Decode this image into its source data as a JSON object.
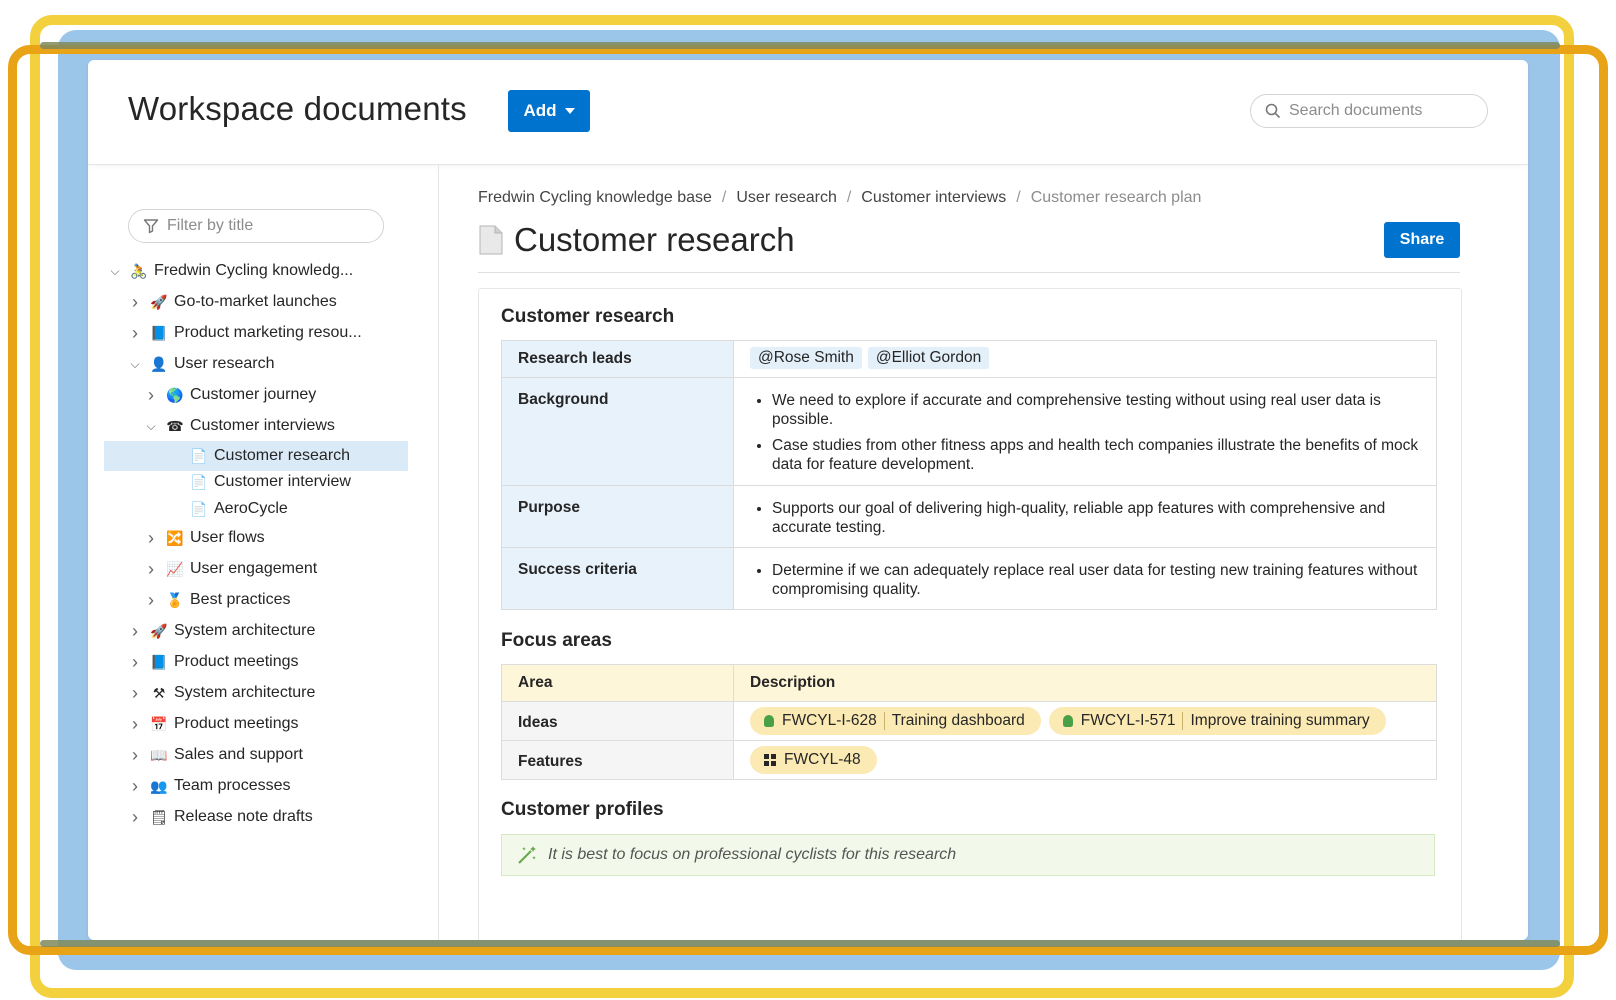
{
  "header": {
    "title": "Workspace documents",
    "add_label": "Add",
    "search_placeholder": "Search documents"
  },
  "sidebar": {
    "filter_placeholder": "Filter by title",
    "items": [
      {
        "label": "Fredwin Cycling knowledg...",
        "icon": "cyclist-icon",
        "glyph": "🚴",
        "expanded": true,
        "depth": 0
      },
      {
        "label": "Go-to-market launches",
        "icon": "rocket-icon",
        "glyph": "🚀",
        "depth": 1
      },
      {
        "label": "Product marketing resou...",
        "icon": "book-icon",
        "glyph": "📘",
        "depth": 1
      },
      {
        "label": "User research",
        "icon": "user-icon",
        "glyph": "👤",
        "expanded": true,
        "depth": 1
      },
      {
        "label": "Customer journey",
        "icon": "globe-icon",
        "glyph": "🌎",
        "depth": 2
      },
      {
        "label": "Customer interviews",
        "icon": "phone-icon",
        "glyph": "☎",
        "expanded": true,
        "depth": 2
      },
      {
        "label": "Customer research",
        "icon": "document-icon",
        "glyph": "📄",
        "depth": 3,
        "selected": true
      },
      {
        "label": "Customer interview",
        "icon": "document-icon",
        "glyph": "📄",
        "depth": 3
      },
      {
        "label": "AeroCycle",
        "icon": "document-icon",
        "glyph": "📄",
        "depth": 3
      },
      {
        "label": "User flows",
        "icon": "flow-icon",
        "glyph": "🔀",
        "depth": 2
      },
      {
        "label": "User engagement",
        "icon": "chart-icon",
        "glyph": "📈",
        "depth": 2
      },
      {
        "label": "Best practices",
        "icon": "medal-icon",
        "glyph": "🏅",
        "depth": 2
      },
      {
        "label": "System architecture",
        "icon": "rocket-icon",
        "glyph": "🚀",
        "depth": 1
      },
      {
        "label": "Product meetings",
        "icon": "book-icon",
        "glyph": "📘",
        "depth": 1
      },
      {
        "label": "System architecture",
        "icon": "tools-icon",
        "glyph": "⚒",
        "depth": 1
      },
      {
        "label": "Product meetings",
        "icon": "calendar-icon",
        "glyph": "📅",
        "depth": 1
      },
      {
        "label": "Sales and support",
        "icon": "open-book-icon",
        "glyph": "📖",
        "depth": 1
      },
      {
        "label": "Team processes",
        "icon": "people-icon",
        "glyph": "👥",
        "depth": 1
      },
      {
        "label": "Release note drafts",
        "icon": "notepad-icon",
        "glyph": "🗒",
        "depth": 1
      }
    ]
  },
  "breadcrumb": [
    "Fredwin Cycling knowledge base",
    "User research",
    "Customer interviews",
    "Customer research plan"
  ],
  "document": {
    "title": "Customer research",
    "share_label": "Share",
    "section1_title": "Customer research",
    "research_leads_label": "Research leads",
    "research_leads": [
      "@Rose Smith",
      "@Elliot Gordon"
    ],
    "background_label": "Background",
    "background": [
      "We need to explore if accurate and comprehensive testing without using real user data is possible.",
      "Case studies from other fitness apps and health tech companies illustrate the benefits of mock data for feature development."
    ],
    "purpose_label": "Purpose",
    "purpose": [
      "Supports our goal of delivering high-quality, reliable app features with comprehensive and accurate testing."
    ],
    "success_label": "Success criteria",
    "success": [
      "Determine if we can adequately replace real user data for testing new training features without compromising quality."
    ],
    "section2_title": "Focus areas",
    "focus_head": [
      "Area",
      "Description"
    ],
    "ideas_label": "Ideas",
    "ideas": [
      {
        "id": "FWCYL-I-628",
        "name": "Training dashboard"
      },
      {
        "id": "FWCYL-I-571",
        "name": "Improve training summary"
      }
    ],
    "features_label": "Features",
    "features": [
      {
        "id": "FWCYL-48"
      }
    ],
    "section3_title": "Customer profiles",
    "tip": "It is best to focus on professional cyclists for this research"
  },
  "colors": {
    "accent": "#0073cf",
    "selected": "#dbeaf7",
    "chip": "#fbeab3"
  }
}
